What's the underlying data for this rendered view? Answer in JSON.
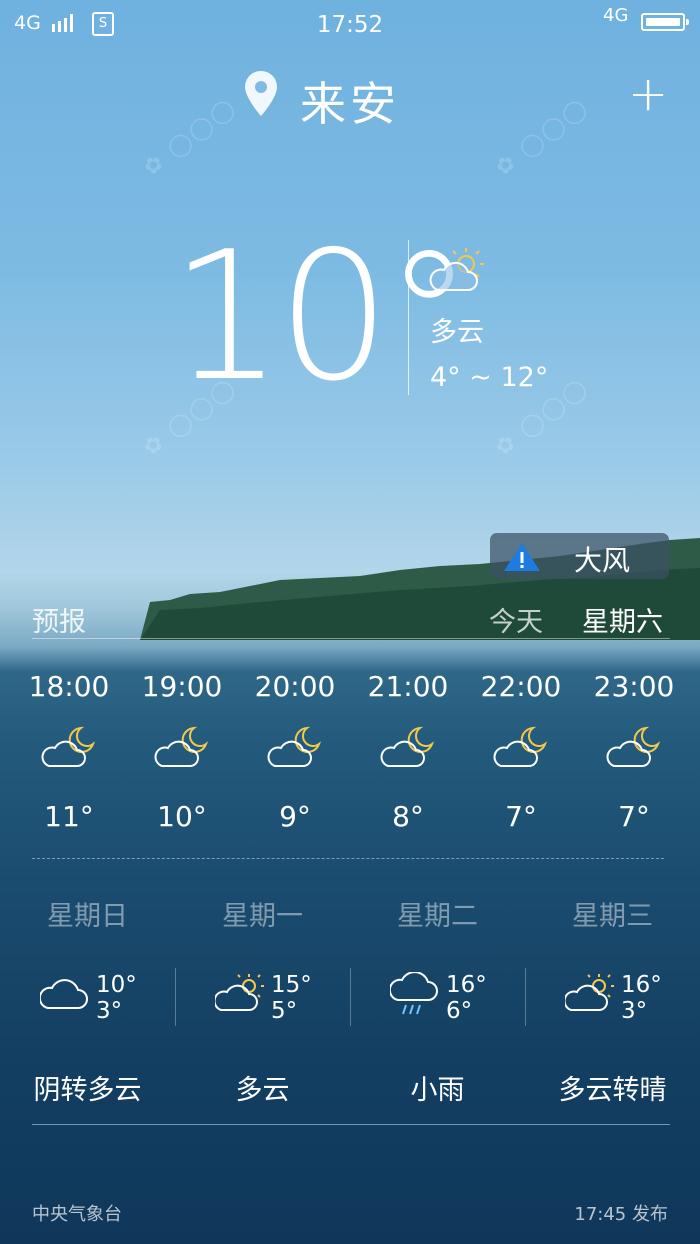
{
  "status": {
    "network": "4G",
    "time": "17:52",
    "network2": "4G",
    "sim": "S"
  },
  "header": {
    "city": "来安",
    "add": "+"
  },
  "current": {
    "temp": "10°",
    "condition": "多云",
    "range": "4° ~ 12°"
  },
  "alert": {
    "label": "大风"
  },
  "forecast": {
    "label": "预报",
    "today": "今天",
    "weekday": "星期六"
  },
  "hourly": [
    {
      "time": "18:00",
      "temp": "11°",
      "icon": "cloud-moon-icon"
    },
    {
      "time": "19:00",
      "temp": "10°",
      "icon": "cloud-moon-icon"
    },
    {
      "time": "20:00",
      "temp": "9°",
      "icon": "cloud-moon-icon"
    },
    {
      "time": "21:00",
      "temp": "8°",
      "icon": "cloud-moon-icon"
    },
    {
      "time": "22:00",
      "temp": "7°",
      "icon": "cloud-moon-icon"
    },
    {
      "time": "23:00",
      "temp": "7°",
      "icon": "cloud-moon-icon"
    }
  ],
  "daily": [
    {
      "day": "星期日",
      "high": "10°",
      "low": "3°",
      "condition": "阴转多云",
      "icon": "cloud-icon"
    },
    {
      "day": "星期一",
      "high": "15°",
      "low": "5°",
      "condition": "多云",
      "icon": "cloud-sun-icon"
    },
    {
      "day": "星期二",
      "high": "16°",
      "low": "6°",
      "condition": "小雨",
      "icon": "cloud-rain-icon"
    },
    {
      "day": "星期三",
      "high": "16°",
      "low": "3°",
      "condition": "多云转晴",
      "icon": "cloud-sun-icon"
    }
  ],
  "footer": {
    "source": "中央气象台",
    "published": "17:45 发布"
  },
  "colors": {
    "sun": "#f2c94c",
    "rain": "#6fc3ff",
    "alert_icon": "#1e7be0"
  }
}
